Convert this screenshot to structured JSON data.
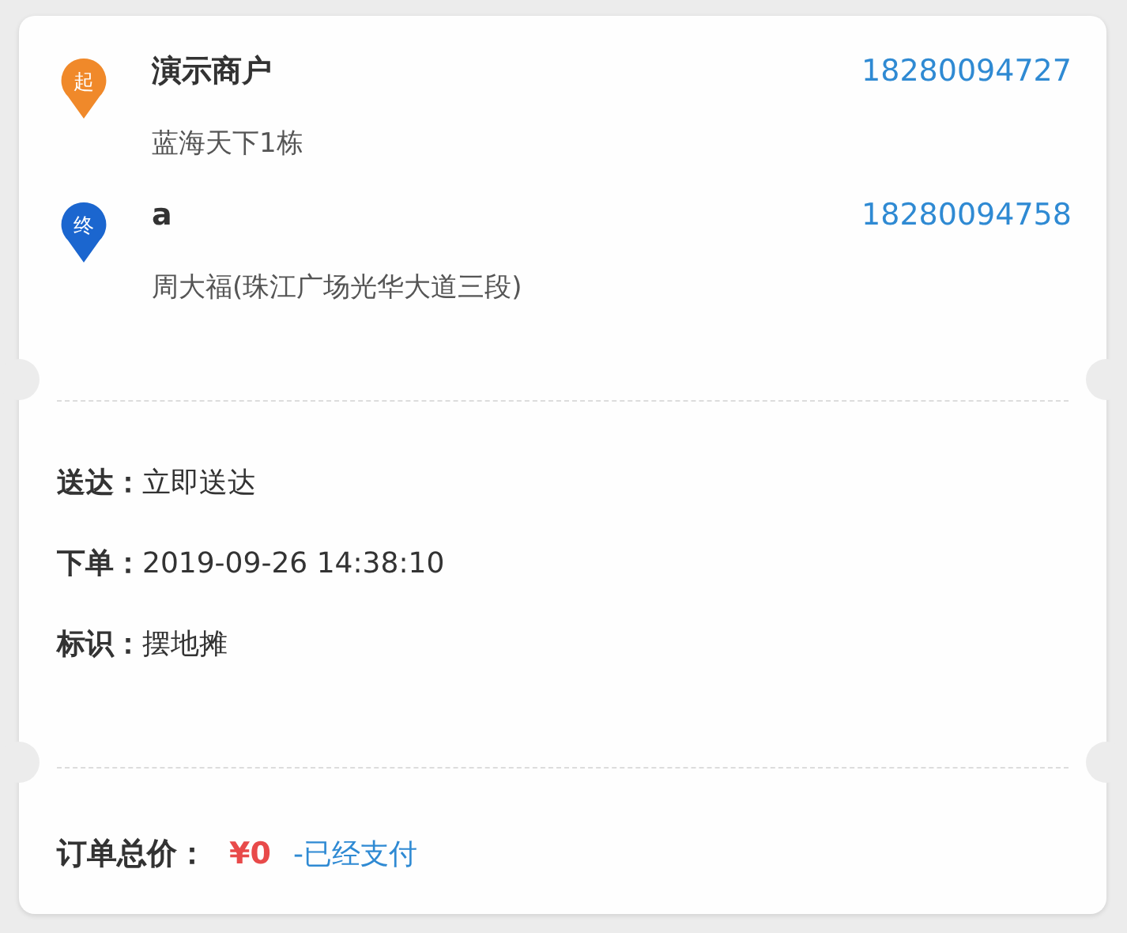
{
  "stops": [
    {
      "pin_label": "起",
      "color": "#f0892a",
      "name": "演示商户",
      "phone": "18280094727",
      "address": "蓝海天下1栋"
    },
    {
      "pin_label": "终",
      "color": "#1b66cf",
      "name": "a",
      "phone": "18280094758",
      "address": "周大福(珠江广场光华大道三段)"
    }
  ],
  "details": [
    {
      "label": "送达：",
      "value": "立即送达"
    },
    {
      "label": "下单：",
      "value": "2019-09-26 14:38:10"
    },
    {
      "label": "标识：",
      "value": "摆地摊"
    }
  ],
  "total": {
    "label": "订单总价：",
    "price": "¥0",
    "status": "-已经支付"
  }
}
